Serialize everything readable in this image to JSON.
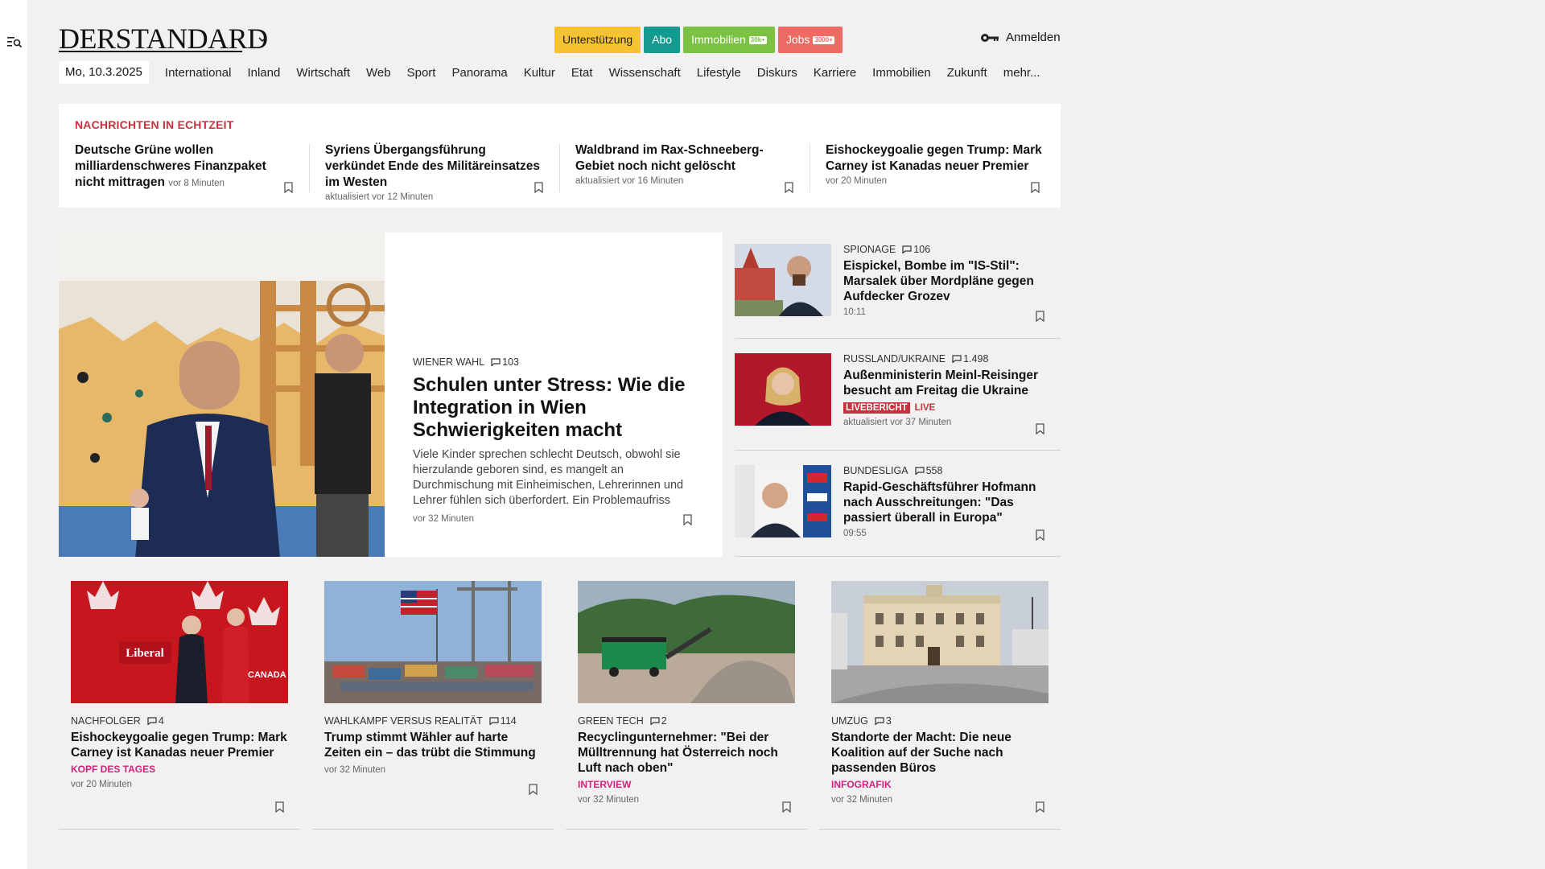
{
  "header": {
    "logo": "DERSTANDARD",
    "pills": {
      "unterstuetzung": "Unterstützung",
      "abo": "Abo",
      "immobilien": "Immobilien",
      "immobilien_badge": "30k+",
      "jobs": "Jobs",
      "jobs_badge": "3000+"
    },
    "login": "Anmelden",
    "date": "Mo, 10.3.2025",
    "nav": [
      "International",
      "Inland",
      "Wirtschaft",
      "Web",
      "Sport",
      "Panorama",
      "Kultur",
      "Etat",
      "Wissenschaft",
      "Lifestyle",
      "Diskurs",
      "Karriere",
      "Immobilien",
      "Zukunft",
      "mehr..."
    ]
  },
  "live": {
    "title": "NACHRICHTEN IN ECHTZEIT",
    "items": [
      {
        "headline": "Deutsche Grüne wollen milliardenschweres Finanzpaket nicht mittragen",
        "meta": "vor 8 Minuten"
      },
      {
        "headline": "Syriens Übergangsführung verkündet Ende des Militäreinsatzes im Westen",
        "meta": "aktualisiert vor 12 Minuten"
      },
      {
        "headline": "Waldbrand im Rax-Schneeberg-Gebiet noch nicht gelöscht",
        "meta": "aktualisiert vor 16 Minuten"
      },
      {
        "headline": "Eishockeygoalie gegen Trump: Mark Carney ist Kanadas neuer Premier",
        "meta": "vor 20 Minuten"
      }
    ]
  },
  "lead": {
    "kicker": "WIENER WAHL",
    "comments": "103",
    "title": "Schulen unter Stress: Wie die Integration in Wien Schwierigkeiten macht",
    "teaser": "Viele Kinder sprechen schlecht Deutsch, obwohl sie hierzulande geboren sind, es mangelt an Durchmischung mit Einheimischen, Lehrerinnen und Lehrer fühlen sich überfordert. Ein Problemaufriss",
    "time": "vor 32 Minuten"
  },
  "side": [
    {
      "kicker": "SPIONAGE",
      "comments": "106",
      "title": "Eispickel, Bombe im \"IS-Stil\": Marsalek über Mordpläne gegen Aufdecker Grozev",
      "meta": "10:11"
    },
    {
      "kicker": "RUSSLAND/UKRAINE",
      "comments": "1.498",
      "title": "Außenministerin Meinl-Reisinger besucht am Freitag die Ukraine",
      "badge": "LIVEBERICHT",
      "live": "LIVE",
      "meta": "aktualisiert vor 37 Minuten"
    },
    {
      "kicker": "BUNDESLIGA",
      "comments": "558",
      "title": "Rapid-Geschäftsführer Hofmann nach Ausschreitungen: \"Das passiert überall in Europa\"",
      "meta": "09:55"
    }
  ],
  "cards": [
    {
      "kicker": "NACHFOLGER",
      "comments": "4",
      "title": "Eishockeygoalie gegen Trump: Mark Carney ist Kanadas neuer Premier",
      "tag": "KOPF DES TAGES",
      "meta": "vor 20 Minuten"
    },
    {
      "kicker": "WAHLKAMPF VERSUS REALITÄT",
      "comments": "114",
      "title": "Trump stimmt Wähler auf harte Zeiten ein – das trübt die Stimmung",
      "tag": "",
      "meta": "vor 32 Minuten"
    },
    {
      "kicker": "GREEN TECH",
      "comments": "2",
      "title": "Recyclingunternehmer: \"Bei der Mülltrennung hat Österreich noch Luft nach oben\"",
      "tag": "INTERVIEW",
      "meta": "vor 32 Minuten"
    },
    {
      "kicker": "UMZUG",
      "comments": "3",
      "title": "Standorte der Macht: Die neue Koalition auf der Suche nach passenden Büros",
      "tag": "INFOGRAFIK",
      "meta": "vor 32 Minuten"
    }
  ],
  "images": {
    "card1_sign": "Liberal",
    "card1_slogan": "CANADA STRONG"
  },
  "colors": {
    "live_red": "#c6313d",
    "tag_magenta": "#d4217f",
    "abo_teal": "#149a8e",
    "immo_green": "#7cc242",
    "jobs_red": "#ee6b63",
    "support_yellow": "#f5c230"
  }
}
